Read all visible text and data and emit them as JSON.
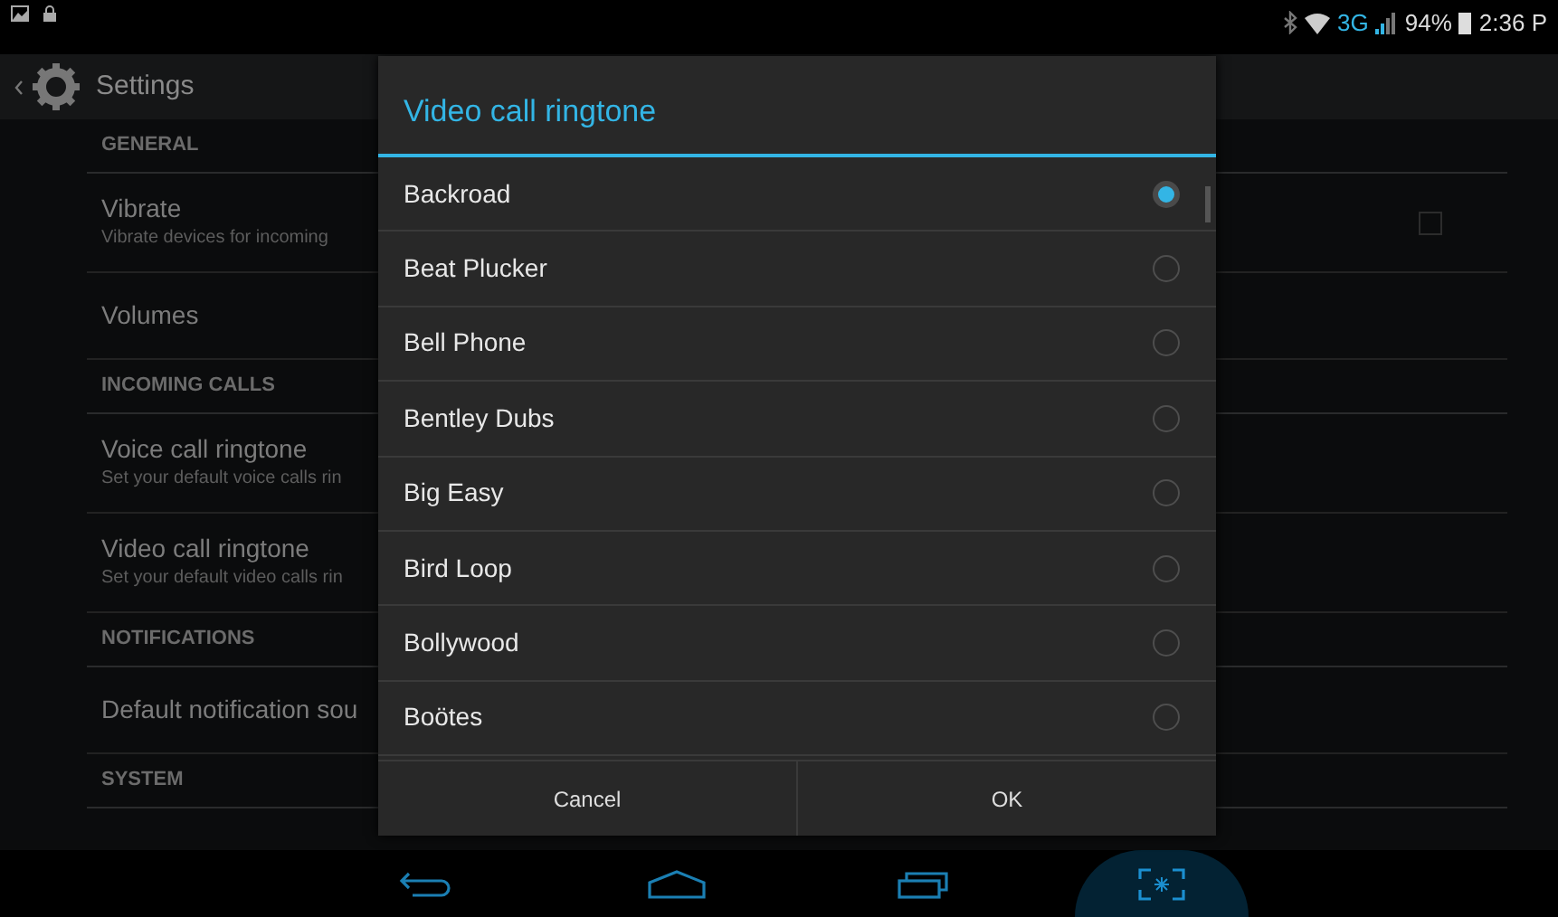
{
  "status_bar": {
    "network": "3G",
    "battery": "94%",
    "time": "2:36 P"
  },
  "action_bar": {
    "title": "Settings"
  },
  "settings": [
    {
      "kind": "header",
      "title": "GENERAL"
    },
    {
      "kind": "check",
      "title": "Vibrate",
      "summary": "Vibrate devices for incoming",
      "checked": false
    },
    {
      "kind": "item",
      "title": "Volumes"
    },
    {
      "kind": "header",
      "title": "INCOMING CALLS"
    },
    {
      "kind": "item",
      "title": "Voice call ringtone",
      "summary": "Set your default voice calls rin"
    },
    {
      "kind": "item",
      "title": "Video call ringtone",
      "summary": "Set your default video calls rin"
    },
    {
      "kind": "header",
      "title": "NOTIFICATIONS"
    },
    {
      "kind": "item",
      "title": "Default notification sou"
    },
    {
      "kind": "header",
      "title": "SYSTEM"
    }
  ],
  "dialog": {
    "title": "Video call ringtone",
    "options": [
      {
        "label": "Backroad",
        "selected": true
      },
      {
        "label": "Beat Plucker",
        "selected": false
      },
      {
        "label": "Bell Phone",
        "selected": false
      },
      {
        "label": "Bentley Dubs",
        "selected": false
      },
      {
        "label": "Big Easy",
        "selected": false
      },
      {
        "label": "Bird Loop",
        "selected": false
      },
      {
        "label": "Bollywood",
        "selected": false
      },
      {
        "label": "Boötes",
        "selected": false
      }
    ],
    "buttons": [
      "Cancel",
      "OK"
    ]
  }
}
